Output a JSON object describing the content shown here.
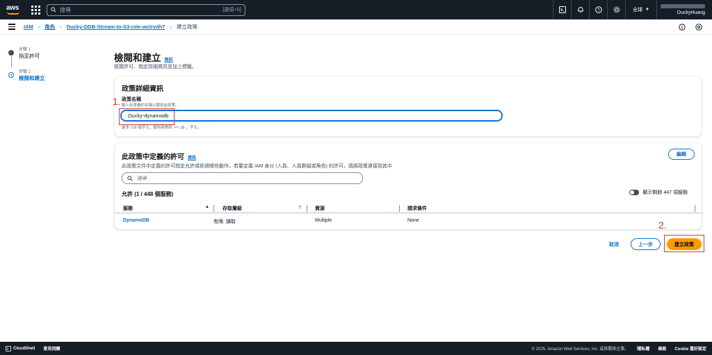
{
  "topnav": {
    "logo": "aws",
    "search_placeholder": "搜尋",
    "search_shortcut": "[選項+S]",
    "region": "全球",
    "account_name": "DuckyHuang"
  },
  "breadcrumb": {
    "items": [
      "IAM",
      "角色",
      "Ducky-DDB-Stream-to-S3-role-wclrvdh7"
    ],
    "current": "建立政策"
  },
  "steps": [
    {
      "number": "步驟 1",
      "title": "指定許可"
    },
    {
      "number": "步驟 2",
      "title": "檢閱和建立"
    }
  ],
  "page": {
    "title": "檢閱和建立",
    "info": "資訊",
    "description": "檢閱許可、指定詳細資訊並加上標籤。"
  },
  "details_card": {
    "title": "政策詳細資訊",
    "name_label": "政策名稱",
    "name_hint": "輸入有意義的名稱以識別此政策。",
    "name_value": "Ducky-dynamodb",
    "constraint": "最多 128 個字元，使用英數和 '+=,.@-_' 字元。"
  },
  "perms_card": {
    "title": "此政策中定義的許可",
    "info": "資訊",
    "description": "此政策文件中定義的許可指定允許或拒絕哪些動作。若要定義 IAM 身分 (人員、人員群組或角色) 的許可，請將政策連接到其中",
    "edit_label": "編輯",
    "search_placeholder": "搜尋",
    "allow_heading": "允許 (1 / 448 個服務)",
    "toggle_label": "顯示剩餘 447 項服務",
    "columns": [
      "服務",
      "存取層級",
      "資源",
      "請求條件"
    ],
    "rows": [
      {
        "service": "DynamoDB",
        "access": "有限: 讀取",
        "resource": "Multiple",
        "condition": "None"
      }
    ]
  },
  "actions": {
    "cancel": "取消",
    "previous": "上一步",
    "create": "建立政策"
  },
  "annotations": {
    "one": "1.",
    "two": "2."
  },
  "footer": {
    "cloudshell": "CloudShell",
    "feedback": "意見回饋",
    "copyright": "© 2025, Amazon Web Services, Inc. 或其關係企業。",
    "privacy": "隱私權",
    "terms": "條款",
    "cookie": "Cookie 喜好設定"
  },
  "colors": {
    "accent": "#0972d3",
    "primary_button": "#ff9900",
    "nav_bg": "#161d26",
    "annotation": "#e0323a"
  }
}
